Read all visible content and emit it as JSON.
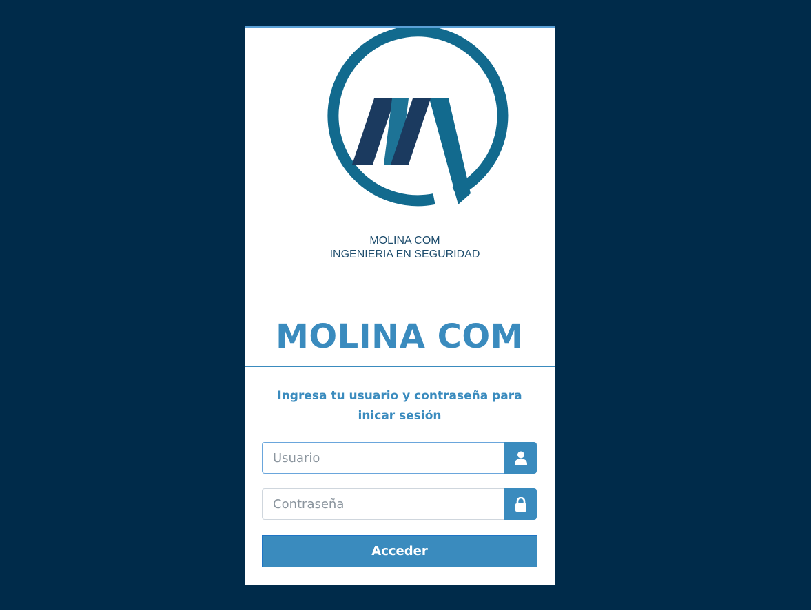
{
  "logo": {
    "caption_line1": "MOLINA COM",
    "caption_line2": "INGENIERIA EN SEGURIDAD"
  },
  "brand": {
    "title": "MOLINA COM"
  },
  "login": {
    "instructions": "Ingresa tu usuario y contraseña para inicar sesión",
    "username_placeholder": "Usuario",
    "username_value": "",
    "username_icon": "user-icon",
    "password_placeholder": "Contraseña",
    "password_value": "",
    "password_icon": "lock-icon",
    "submit_label": "Acceder"
  },
  "colors": {
    "page_background": "#002b4a",
    "accent": "#3a8bbe",
    "logo_ring": "#126a8e",
    "logo_dark": "#1b3a5f"
  }
}
